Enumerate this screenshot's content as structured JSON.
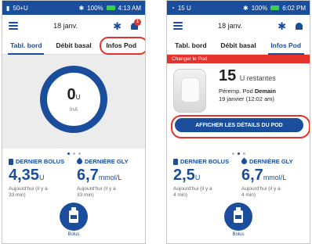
{
  "colors": {
    "primary": "#1a4d9c",
    "alert": "#e5322d",
    "battery": "#3bd14e"
  },
  "left": {
    "status": {
      "left": "50+U",
      "bluetooth": "✱",
      "battery_pct": "100%",
      "time": "4:13 AM"
    },
    "header": {
      "date": "18 janv.",
      "notification_count": "1"
    },
    "tabs": [
      {
        "label": "Tabl. bord"
      },
      {
        "label": "Débit basal"
      },
      {
        "label": "Infos Pod"
      }
    ],
    "active_tab": "Tabl. bord",
    "dashboard": {
      "insulin_value": "0",
      "insulin_unit": "U",
      "insulin_label": "InA"
    },
    "stats": {
      "bolus": {
        "title": "DERNIER BOLUS",
        "value": "4,35",
        "unit": "U",
        "sub1": "Aujourd'hui (il y a",
        "sub2": "33 min)"
      },
      "gly": {
        "title": "DERNIÈRE GLY",
        "value": "6,7",
        "unit": "mmol/L",
        "sub1": "Aujourd'hui (il y a",
        "sub2": "33 min)"
      }
    },
    "bolus_label": "Bolus"
  },
  "right": {
    "status": {
      "left": "15 U",
      "bluetooth": "✱",
      "battery_pct": "100%",
      "time": "6:02 PM"
    },
    "header": {
      "date": "18 janv."
    },
    "tabs": [
      {
        "label": "Tabl. bord"
      },
      {
        "label": "Débit basal"
      },
      {
        "label": "Infos Pod"
      }
    ],
    "active_tab": "Infos Pod",
    "pod": {
      "banner": "Changer le Pod",
      "units": "15",
      "units_label": "U restantes",
      "expiry_label": "Péremp. Pod",
      "expiry_value": "Demain",
      "expiry_date": "19 janvier (12:02 am)",
      "details_button": "AFFICHER LES DÉTAILS DU POD"
    },
    "stats": {
      "bolus": {
        "title": "DERNIER BOLUS",
        "value": "2,5",
        "unit": "U",
        "sub1": "Aujourd'hui (il y a",
        "sub2": "4 min)"
      },
      "gly": {
        "title": "DERNIÈRE GLY",
        "value": "6,7",
        "unit": "mmol/L",
        "sub1": "Aujourd'hui (il y a",
        "sub2": "4 min)"
      }
    },
    "bolus_label": "Bolus"
  }
}
